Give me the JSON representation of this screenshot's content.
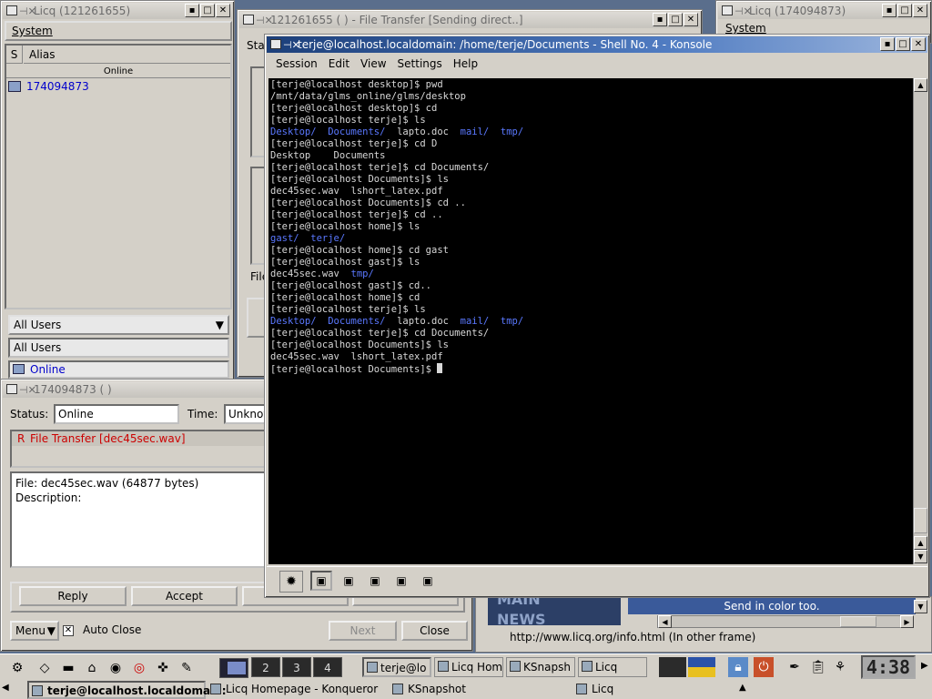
{
  "licq_left": {
    "title": "Licq (121261655)",
    "menu": "System",
    "col_s": "S",
    "col_alias": "Alias",
    "group_header": "Online",
    "contact": "174094873",
    "group_select": "All Users",
    "group_label": "All Users",
    "status": "Online"
  },
  "file_transfer": {
    "title": "121261655 ( ) - File Transfer [Sending direct..]",
    "status_partial": "Stat",
    "file_partial": "File"
  },
  "licq_right": {
    "title": "Licq (174094873)",
    "menu": "System"
  },
  "event_window": {
    "title": "174094873 ( )",
    "status_label": "Status:",
    "status_value": "Online",
    "time_label": "Time:",
    "time_value": "Unknow",
    "event_flag": "R",
    "event_title": "File Transfer [dec45sec.wav]",
    "file_info": "File: dec45sec.wav (64877 bytes)",
    "description": "Description:",
    "reply_button": "Reply",
    "accept_button": "Accept",
    "menu_button": "Menu",
    "auto_close": "Auto Close",
    "next_button": "Next",
    "close_button": "Close"
  },
  "konqueror_bg": {
    "send_color": "Send in color too.",
    "url_status": "http://www.licq.org/info.html (In other frame)",
    "news": "NEWS",
    "main": "MAIN"
  },
  "konsole": {
    "title": "terje@localhost.localdomain: /home/terje/Documents - Shell No. 4 - Konsole",
    "menu": [
      "Session",
      "Edit",
      "View",
      "Settings",
      "Help"
    ],
    "lines": [
      [
        {
          "t": "[terje@localhost desktop]$ pwd"
        }
      ],
      [
        {
          "t": "/mnt/data/glms_online/glms/desktop"
        }
      ],
      [
        {
          "t": "[terje@localhost desktop]$ cd"
        }
      ],
      [
        {
          "t": "[terje@localhost terje]$ ls"
        }
      ],
      [
        {
          "t": "Desktop/",
          "d": true
        },
        {
          "t": "  "
        },
        {
          "t": "Documents/",
          "d": true
        },
        {
          "t": "  lapto.doc  "
        },
        {
          "t": "mail/",
          "d": true
        },
        {
          "t": "  "
        },
        {
          "t": "tmp/",
          "d": true
        }
      ],
      [
        {
          "t": "[terje@localhost terje]$ cd D"
        }
      ],
      [
        {
          "t": "Desktop    Documents"
        }
      ],
      [
        {
          "t": "[terje@localhost terje]$ cd Documents/"
        }
      ],
      [
        {
          "t": "[terje@localhost Documents]$ ls"
        }
      ],
      [
        {
          "t": "dec45sec.wav  lshort_latex.pdf"
        }
      ],
      [
        {
          "t": "[terje@localhost Documents]$ cd .."
        }
      ],
      [
        {
          "t": "[terje@localhost terje]$ cd .."
        }
      ],
      [
        {
          "t": "[terje@localhost home]$ ls"
        }
      ],
      [
        {
          "t": "gast/",
          "d": true
        },
        {
          "t": "  "
        },
        {
          "t": "terje/",
          "d": true
        }
      ],
      [
        {
          "t": "[terje@localhost home]$ cd gast"
        }
      ],
      [
        {
          "t": "[terje@localhost gast]$ ls"
        }
      ],
      [
        {
          "t": "dec45sec.wav  "
        },
        {
          "t": "tmp/",
          "d": true
        }
      ],
      [
        {
          "t": "[terje@localhost gast]$ cd.."
        }
      ],
      [
        {
          "t": "[terje@localhost home]$ cd"
        }
      ],
      [
        {
          "t": "[terje@localhost terje]$ ls"
        }
      ],
      [
        {
          "t": "Desktop/",
          "d": true
        },
        {
          "t": "  "
        },
        {
          "t": "Documents/",
          "d": true
        },
        {
          "t": "  lapto.doc  "
        },
        {
          "t": "mail/",
          "d": true
        },
        {
          "t": "  "
        },
        {
          "t": "tmp/",
          "d": true
        }
      ],
      [
        {
          "t": "[terje@localhost terje]$ cd Documents/"
        }
      ],
      [
        {
          "t": "[terje@localhost Documents]$ ls"
        }
      ],
      [
        {
          "t": "dec45sec.wav  lshort_latex.pdf"
        }
      ],
      [
        {
          "t": "[terje@localhost Documents]$ "
        }
      ]
    ]
  },
  "taskbar": {
    "pager": [
      "2",
      "3",
      "4"
    ],
    "tasks_top": [
      "terje@lo",
      "Licq Hom",
      "KSnapsh",
      "Licq"
    ],
    "tasks_bottom": [
      "terje@localhost.localdomain:",
      "Licq Homepage - Konqueror",
      "KSnapshot",
      "Licq"
    ],
    "clock": "4:38"
  },
  "colors": {
    "dir": "#5a78ff",
    "active_title": "#1c3f7a",
    "online": "#0000cc",
    "event_red": "#cc0000"
  }
}
